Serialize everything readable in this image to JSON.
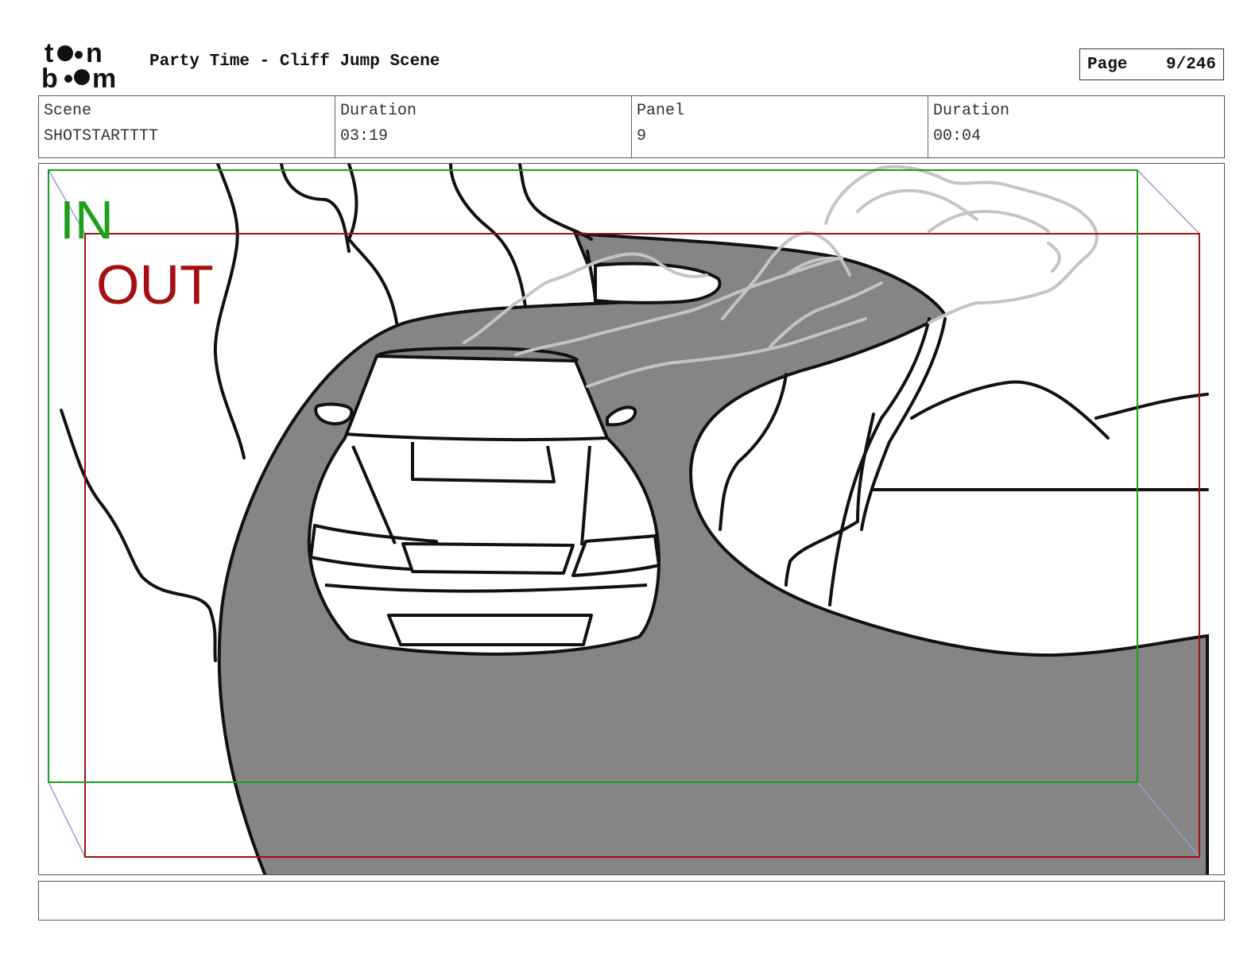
{
  "header": {
    "logo_text": "toon boom",
    "title": "Party Time - Cliff Jump Scene",
    "page_label": "Page",
    "page_value": "9/246"
  },
  "info": {
    "scene_label": "Scene",
    "scene_value": "SHOTSTARTTTT",
    "scene_duration_label": "Duration",
    "scene_duration_value": "03:19",
    "panel_label": "Panel",
    "panel_value": "9",
    "panel_duration_label": "Duration",
    "panel_duration_value": "00:04"
  },
  "panel": {
    "in_label": "IN",
    "out_label": "OUT",
    "in_color": "#1aa01a",
    "out_color": "#a50f0f",
    "road_color": "#858585",
    "smoke_color": "#c4c4c4"
  },
  "caption": {
    "text": ""
  }
}
